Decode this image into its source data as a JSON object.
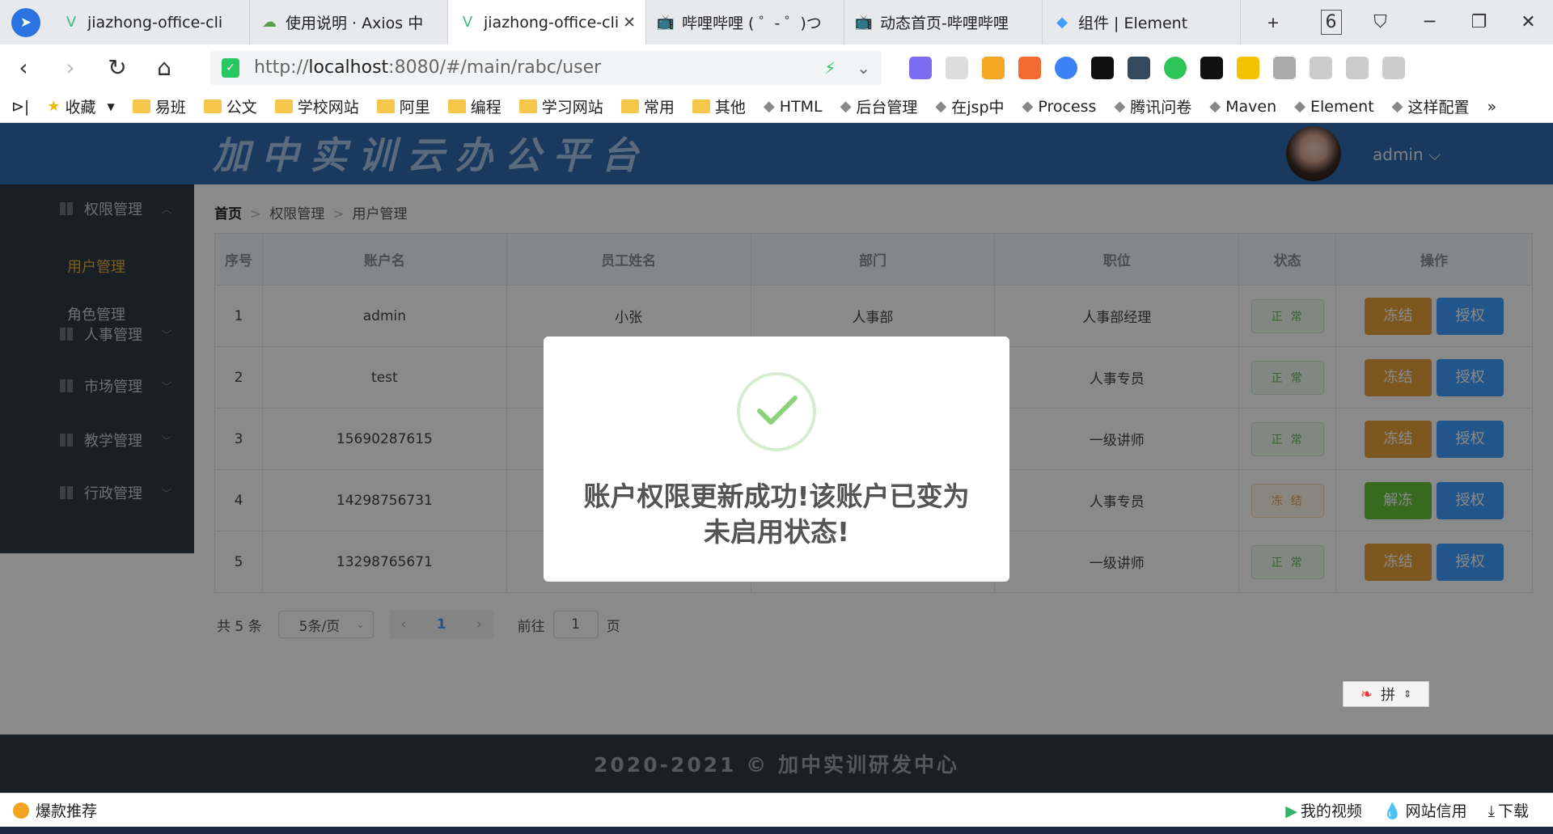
{
  "browser": {
    "tabs": [
      {
        "title": "jiazhong-office-cli",
        "icon": "V",
        "color": "#41b883"
      },
      {
        "title": "使用说明 · Axios 中",
        "icon": "☁",
        "color": "#5a9e4a"
      },
      {
        "title": "jiazhong-office-cli",
        "icon": "V",
        "color": "#41b883"
      },
      {
        "title": "哔哩哔哩 ( ゜- ゜)つ",
        "icon": "📺",
        "color": "#23ade5"
      },
      {
        "title": "动态首页-哔哩哔哩",
        "icon": "📺",
        "color": "#23ade5"
      },
      {
        "title": "组件 | Element",
        "icon": "◆",
        "color": "#409eff"
      }
    ],
    "new_tab": "+",
    "tab_count": "6",
    "url_protocol": "http://",
    "url_host": "localhost",
    "url_rest": ":8080/#/main/rabc/user",
    "bookmarks": [
      "收藏",
      "易班",
      "公文",
      "学校网站",
      "阿里",
      "编程",
      "学习网站",
      "常用",
      "其他",
      "HTML",
      "后台管理",
      "在jsp中",
      "Process",
      "腾讯问卷",
      "Maven",
      "Element",
      "这样配置"
    ],
    "more": "»"
  },
  "app": {
    "title": "加中实训云办公平台",
    "user": "admin",
    "user_chevron": "⌵"
  },
  "sidebar": {
    "groups": [
      {
        "label": "权限管理",
        "chev": "︿"
      },
      {
        "label": "人事管理",
        "chev": "﹀"
      },
      {
        "label": "市场管理",
        "chev": "﹀"
      },
      {
        "label": "教学管理",
        "chev": "﹀"
      },
      {
        "label": "行政管理",
        "chev": "﹀"
      }
    ],
    "subs": [
      {
        "label": "用户管理",
        "active": true
      },
      {
        "label": "角色管理",
        "active": false
      }
    ]
  },
  "breadcrumb": {
    "home": "首页",
    "level1": "权限管理",
    "level2": "用户管理"
  },
  "table": {
    "headers": [
      "序号",
      "账户名",
      "员工姓名",
      "部门",
      "职位",
      "状态",
      "操作"
    ],
    "rows": [
      {
        "no": "1",
        "account": "admin",
        "name": "小张",
        "dept": "人事部",
        "position": "人事部经理",
        "status": "正常",
        "frozen": false,
        "action1": "冻结",
        "action2": "授权"
      },
      {
        "no": "2",
        "account": "test",
        "name": "",
        "dept": "",
        "position": "人事专员",
        "status": "正常",
        "frozen": false,
        "action1": "冻结",
        "action2": "授权"
      },
      {
        "no": "3",
        "account": "15690287615",
        "name": "",
        "dept": "",
        "position": "一级讲师",
        "status": "正常",
        "frozen": false,
        "action1": "冻结",
        "action2": "授权"
      },
      {
        "no": "4",
        "account": "14298756731",
        "name": "",
        "dept": "",
        "position": "人事专员",
        "status": "冻结",
        "frozen": true,
        "action1": "解冻",
        "action2": "授权"
      },
      {
        "no": "5",
        "account": "13298765671",
        "name": "",
        "dept": "",
        "position": "一级讲师",
        "status": "正常",
        "frozen": false,
        "action1": "冻结",
        "action2": "授权"
      }
    ]
  },
  "pagination": {
    "total": "共 5 条",
    "page_size": "5条/页",
    "current": "1",
    "goto_label": "前往",
    "goto_value": "1",
    "page_suffix": "页"
  },
  "footer": "2020-2021 © 加中实训研发中心",
  "modal": {
    "message": "账户权限更新成功!该账户已变为未启用状态!"
  },
  "ime": {
    "label": "拼"
  },
  "statusbar": {
    "left": "爆款推荐",
    "items": [
      "我的视频",
      "网站信用",
      "下载"
    ]
  },
  "colors": {
    "header": "#2f6cae",
    "sidebar": "#2f3a44",
    "active_menu": "#e0b13f",
    "primary": "#409eff",
    "warning": "#e6a23c",
    "success": "#67c23a"
  }
}
